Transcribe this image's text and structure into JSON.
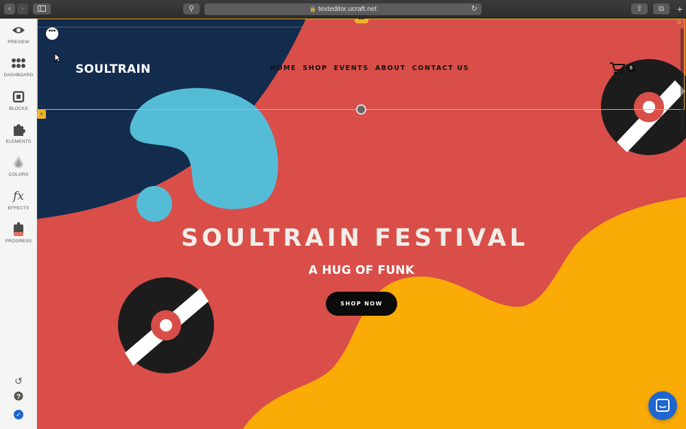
{
  "browser": {
    "url": "texteditor.ucraft.net",
    "back_icon": "chevron-left-icon",
    "forward_icon": "chevron-right-icon"
  },
  "sidebar": {
    "items": [
      {
        "label": "PREVIEW",
        "icon": "eye-icon"
      },
      {
        "label": "DASHBOARD",
        "icon": "grid-icon"
      },
      {
        "label": "BLOCKS",
        "icon": "square-icon"
      },
      {
        "label": "ELEMENTS",
        "icon": "puzzle-icon"
      },
      {
        "label": "COLORS",
        "icon": "palette-icon"
      },
      {
        "label": "EFFECTS",
        "icon": "fx-icon"
      },
      {
        "label": "PROGRESS",
        "icon": "battery-icon"
      }
    ]
  },
  "site": {
    "brand": "SOULTRAIN",
    "nav": [
      "HOME",
      "SHOP",
      "EVENTS",
      "ABOUT",
      "CONTACT US"
    ],
    "cart_count": "0",
    "hero_title": "SOULTRAIN FESTIVAL",
    "hero_subtitle": "A HUG OF FUNK",
    "cta": "SHOP NOW"
  },
  "colors": {
    "background": "#d94e48",
    "navy": "#132b4d",
    "blue": "#55bcd6",
    "yellow": "#fbab06",
    "selection": "#f0b429",
    "accent": "#1e66d0"
  }
}
